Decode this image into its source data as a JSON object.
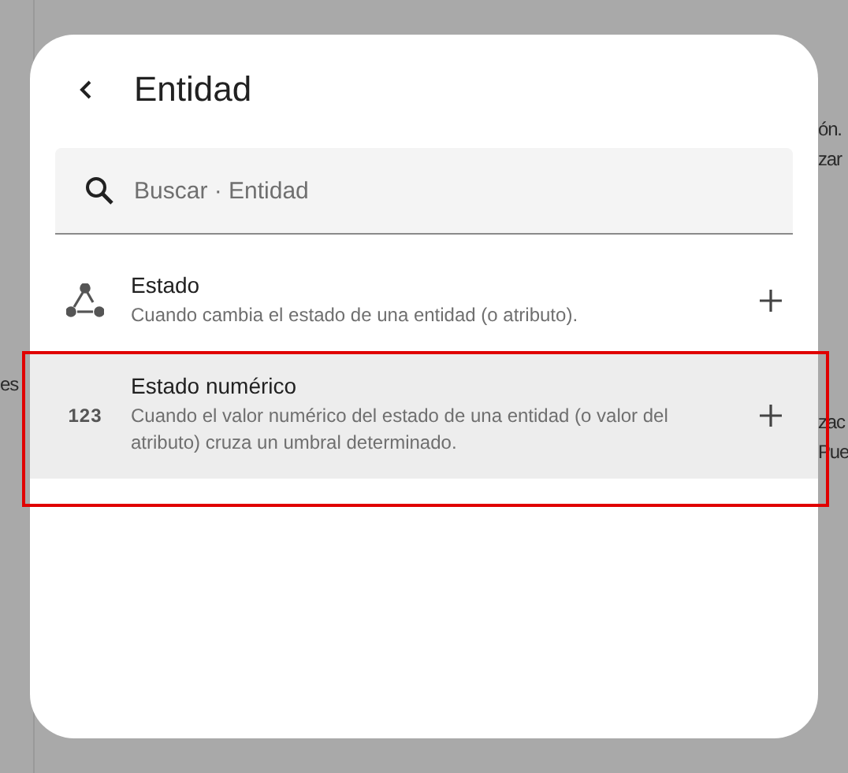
{
  "background_left": [
    "es"
  ],
  "background_right": [
    "ón.",
    "zar",
    "zac",
    "Pue"
  ],
  "dialog": {
    "title": "Entidad",
    "search": {
      "placeholder": "Buscar · Entidad"
    },
    "items": [
      {
        "kind": "state",
        "title": "Estado",
        "description": "Cuando cambia el estado de una entidad (o atributo).",
        "selected": false
      },
      {
        "kind": "numeric",
        "icon_text": "123",
        "title": "Estado numérico",
        "description": "Cuando el valor numérico del estado de una entidad (o valor del atributo) cruza un umbral determinado.",
        "selected": true
      }
    ]
  }
}
